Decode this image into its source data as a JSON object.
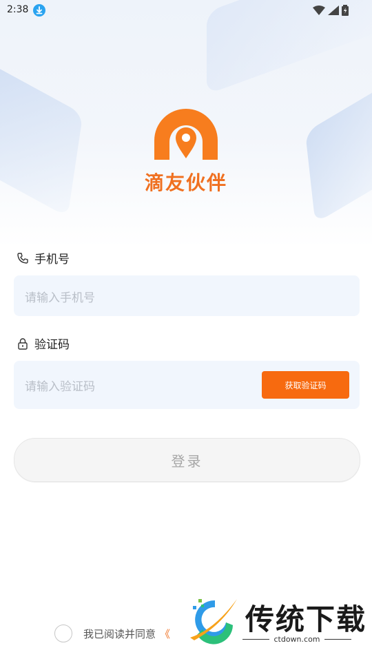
{
  "status_bar": {
    "time": "2:38"
  },
  "app": {
    "name": "滴友伙伴"
  },
  "form": {
    "phone_label": "手机号",
    "phone_placeholder": "请输入手机号",
    "code_label": "验证码",
    "code_placeholder": "请输入验证码",
    "get_code_button": "获取验证码",
    "login_button": "登录"
  },
  "agreement": {
    "text": "我已阅读并同意",
    "link_fragment": "《"
  },
  "watermark": {
    "title": "传统下载",
    "domain": "ctdown.com"
  },
  "colors": {
    "brand_orange": "#f07020",
    "button_orange": "#f76a0f",
    "input_bg": "#f1f6fd"
  }
}
